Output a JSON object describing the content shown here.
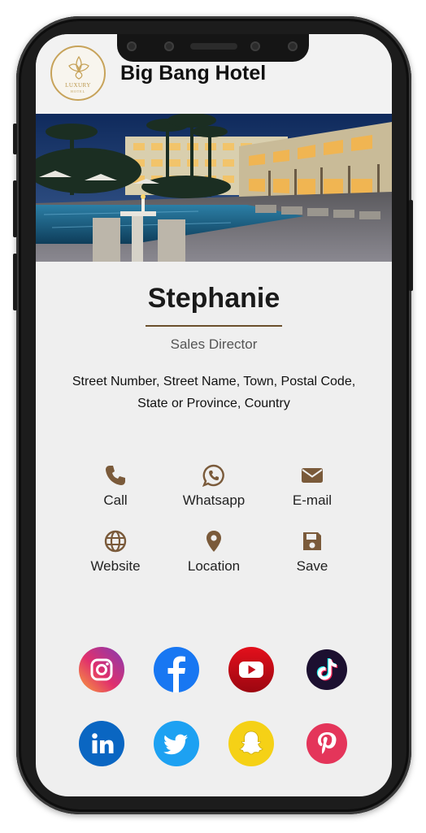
{
  "header": {
    "hotel_name": "Big Bang Hotel",
    "logo_text": "LUXURY",
    "logo_subtext": "HOTEL"
  },
  "profile": {
    "name": "Stephanie",
    "job_title": "Sales Director",
    "address_line1": "Street Number, Street Name, Town, Postal Code,",
    "address_line2": "State or Province, Country"
  },
  "actions": [
    {
      "label": "Call",
      "icon": "phone-icon"
    },
    {
      "label": "Whatsapp",
      "icon": "whatsapp-icon"
    },
    {
      "label": "E-mail",
      "icon": "envelope-icon"
    },
    {
      "label": "Website",
      "icon": "globe-icon"
    },
    {
      "label": "Location",
      "icon": "map-pin-icon"
    },
    {
      "label": "Save",
      "icon": "floppy-disk-icon"
    }
  ],
  "socials": [
    {
      "name": "instagram",
      "icon": "instagram-icon"
    },
    {
      "name": "facebook",
      "icon": "facebook-icon"
    },
    {
      "name": "youtube",
      "icon": "youtube-icon"
    },
    {
      "name": "tiktok",
      "icon": "tiktok-icon"
    },
    {
      "name": "linkedin",
      "icon": "linkedin-icon"
    },
    {
      "name": "twitter",
      "icon": "twitter-icon"
    },
    {
      "name": "snapchat",
      "icon": "snapchat-icon"
    },
    {
      "name": "pinterest",
      "icon": "pinterest-icon"
    }
  ],
  "colors": {
    "icon_brown": "#7a5a3a",
    "accent_gold": "#c7a35a",
    "screen_bg": "#efefef"
  }
}
